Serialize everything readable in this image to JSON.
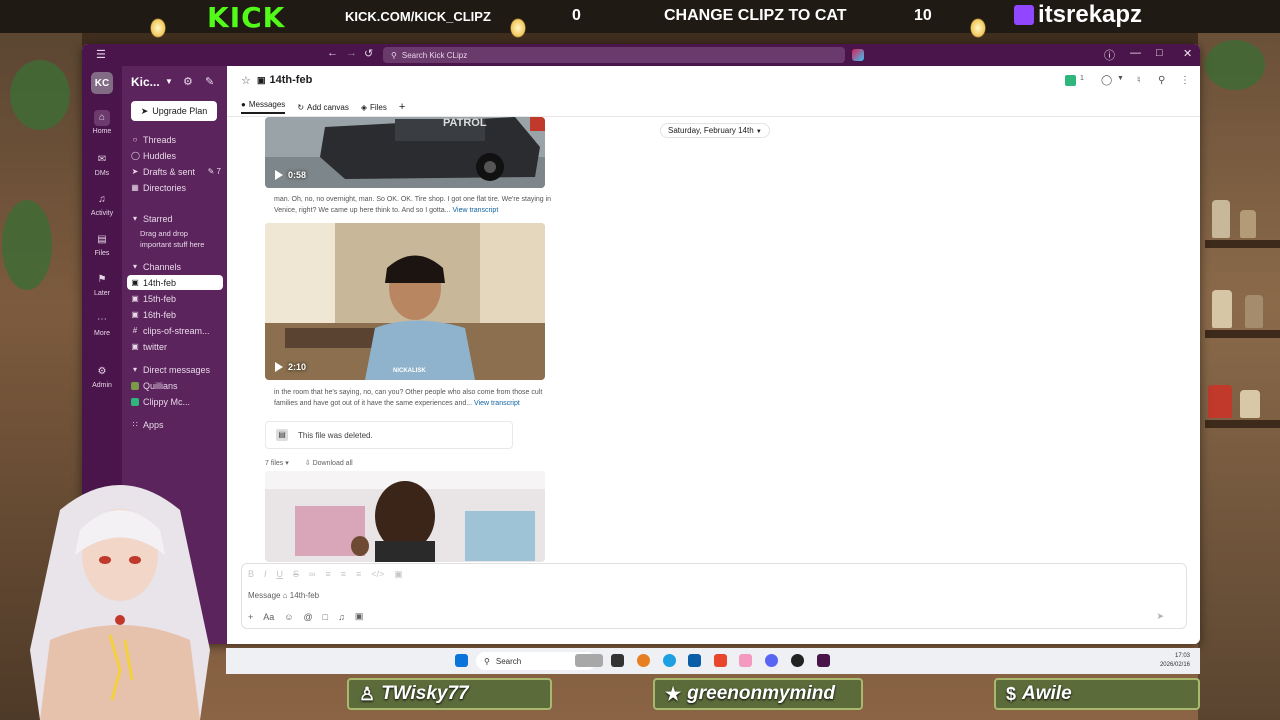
{
  "overlay": {
    "kick_logo": "KICK",
    "kick_url": "KICK.COM/KICK_CLIPZ",
    "left_count": "0",
    "goal_text": "CHANGE CLIPZ TO CAT",
    "right_count": "10",
    "twitch_handle": "itsrekapz",
    "bottom_names": [
      "TWisky77",
      "greenonmymind",
      "Awile"
    ]
  },
  "titlebar": {
    "search_placeholder": "Search Kick CLipz"
  },
  "rail": {
    "workspace_initials": "KC",
    "items": [
      "Home",
      "DMs",
      "Activity",
      "Files",
      "Later",
      "More",
      "Admin"
    ]
  },
  "sidebar": {
    "workspace_name": "Kic...",
    "upgrade_label": "Upgrade Plan",
    "nav": [
      {
        "label": "Threads"
      },
      {
        "label": "Huddles"
      },
      {
        "label": "Drafts & sent",
        "count": "7"
      },
      {
        "label": "Directories"
      }
    ],
    "starred_label": "Starred",
    "starred_note": "Drag and drop important stuff here",
    "channels_label": "Channels",
    "channels": [
      "14th-feb",
      "15th-feb",
      "16th-feb",
      "clips-of-stream...",
      "twitter"
    ],
    "dm_label": "Direct messages",
    "dms": [
      "Quillians",
      "Clippy Mc..."
    ],
    "apps_label": "Apps"
  },
  "channel": {
    "name": "14th-feb",
    "member_count": "1",
    "tabs": [
      "Messages",
      "Add canvas",
      "Files"
    ],
    "date_divider": "Saturday, February 14th"
  },
  "messages": {
    "video1_duration": "0:58",
    "video1_label": "PATROL",
    "transcript1": "man. Oh, no, no overnight, man. So OK. OK. Tire shop. I got one flat tire. We're staying in Venice, right? We came up here think to. And so I gotta...",
    "transcript_link": "View transcript",
    "video2_duration": "2:10",
    "video2_watermark": "NICKALISK",
    "transcript2": "in the room that he's saying, no, can you? Other people who also come from those cult families and have got out of it have the same experiences and...",
    "deleted_text": "This file was deleted.",
    "files_count": "7 files",
    "download_all": "Download all"
  },
  "composer": {
    "placeholder": "Message ⌂ 14th-feb"
  },
  "taskbar": {
    "search_label": "Search",
    "time": "17:03",
    "date": "2026/02/16"
  },
  "colors": {
    "slack_aubergine": "#4a154b",
    "sidebar": "#5b245c",
    "kick_green": "#53fc18",
    "twitch_purple": "#9146ff",
    "link_blue": "#1264a3"
  }
}
